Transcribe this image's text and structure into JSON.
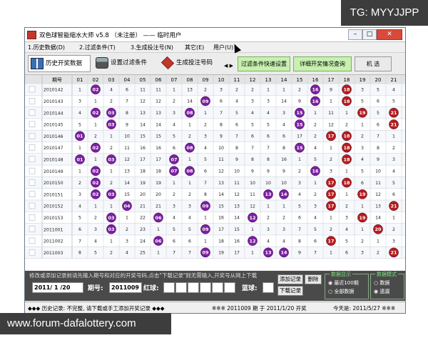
{
  "watermark_top": "TG: MYYJJPP",
  "watermark_bottom": "www.forum-dafalottery.com",
  "window": {
    "title": "双色球智能缩水大师 v5.8 （未注册） —— 临时用户",
    "min": "–",
    "max": "□",
    "close": "✕"
  },
  "menu": [
    "1.历史数据(D)",
    "2.过滤条件(T)",
    "3.生成投注号(N)",
    "其它(E)",
    "用户(U)"
  ],
  "toolbar": {
    "history": "历史开奖数据",
    "filter": "设置过滤条件",
    "generate": "生成投注号码",
    "scroll": "◀ ▶",
    "quick_filter": "过滤条件快速设置",
    "detail": "详细开奖情况查询",
    "machine": "机 选"
  },
  "grid": {
    "issue_header": "期号",
    "columns": [
      "01",
      "02",
      "03",
      "04",
      "05",
      "06",
      "07",
      "08",
      "09",
      "10",
      "11",
      "12",
      "13",
      "14",
      "15",
      "16",
      "17",
      "18",
      "19",
      "20",
      "21"
    ],
    "rows": [
      {
        "issue": "2010142",
        "cells": [
          "1",
          "02",
          "4",
          "6",
          "11",
          "11",
          "1",
          "13",
          "2",
          "3",
          "2",
          "2",
          "1",
          "1",
          "2",
          "16",
          "9",
          "18",
          "3",
          "5",
          "4"
        ],
        "balls": [
          1,
          15,
          17
        ]
      },
      {
        "issue": "2010143",
        "cells": [
          "3",
          "1",
          "2",
          "7",
          "12",
          "12",
          "2",
          "14",
          "09",
          "6",
          "4",
          "3",
          "3",
          "14",
          "9",
          "16",
          "1",
          "18",
          "5",
          "6",
          "5"
        ],
        "balls": [
          8,
          15,
          17
        ]
      },
      {
        "issue": "2010144",
        "cells": [
          "4",
          "02",
          "03",
          "8",
          "13",
          "13",
          "3",
          "08",
          "1",
          "7",
          "5",
          "4",
          "4",
          "3",
          "15",
          "1",
          "11",
          "1",
          "19",
          "5",
          "21"
        ],
        "balls": [
          1,
          2,
          7,
          14,
          18,
          20
        ]
      },
      {
        "issue": "2010145",
        "cells": [
          "5",
          "1",
          "03",
          "9",
          "14",
          "14",
          "4",
          "1",
          "2",
          "8",
          "6",
          "5",
          "5",
          "4",
          "15",
          "2",
          "12",
          "2",
          "1",
          "6",
          "21"
        ],
        "balls": [
          2,
          14,
          20
        ]
      },
      {
        "issue": "2010146",
        "cells": [
          "01",
          "2",
          "1",
          "10",
          "15",
          "15",
          "5",
          "2",
          "3",
          "9",
          "7",
          "6",
          "6",
          "6",
          "17",
          "2",
          "17",
          "18",
          "2",
          "7",
          "1"
        ],
        "balls": [
          0,
          16,
          17
        ]
      },
      {
        "issue": "2010147",
        "cells": [
          "1",
          "02",
          "2",
          "11",
          "16",
          "16",
          "6",
          "08",
          "4",
          "10",
          "8",
          "7",
          "7",
          "8",
          "15",
          "4",
          "1",
          "18",
          "3",
          "8",
          "2"
        ],
        "balls": [
          1,
          7,
          14,
          17
        ]
      },
      {
        "issue": "2010148",
        "cells": [
          "01",
          "1",
          "03",
          "12",
          "17",
          "17",
          "07",
          "1",
          "5",
          "11",
          "9",
          "8",
          "8",
          "16",
          "1",
          "5",
          "2",
          "18",
          "4",
          "9",
          "3"
        ],
        "balls": [
          0,
          2,
          6,
          17
        ]
      },
      {
        "issue": "2010149",
        "cells": [
          "1",
          "02",
          "1",
          "13",
          "18",
          "18",
          "07",
          "08",
          "6",
          "12",
          "10",
          "9",
          "9",
          "9",
          "2",
          "16",
          "3",
          "1",
          "5",
          "10",
          "4"
        ],
        "balls": [
          1,
          6,
          7,
          15
        ]
      },
      {
        "issue": "2010150",
        "cells": [
          "2",
          "02",
          "2",
          "14",
          "19",
          "19",
          "1",
          "1",
          "7",
          "13",
          "11",
          "10",
          "10",
          "10",
          "3",
          "1",
          "17",
          "18",
          "6",
          "11",
          "5"
        ],
        "balls": [
          1,
          16,
          17
        ]
      },
      {
        "issue": "2010151",
        "cells": [
          "3",
          "02",
          "03",
          "15",
          "20",
          "20",
          "2",
          "2",
          "8",
          "14",
          "12",
          "11",
          "13",
          "14",
          "4",
          "2",
          "17",
          "1",
          "19",
          "12",
          "6"
        ],
        "balls": [
          1,
          2,
          12,
          13,
          16,
          18
        ]
      },
      {
        "issue": "2010152",
        "cells": [
          "4",
          "1",
          "1",
          "04",
          "21",
          "21",
          "3",
          "3",
          "09",
          "15",
          "13",
          "12",
          "1",
          "1",
          "5",
          "3",
          "17",
          "2",
          "1",
          "13",
          "21"
        ],
        "balls": [
          3,
          8,
          16,
          20
        ]
      },
      {
        "issue": "2010153",
        "cells": [
          "5",
          "2",
          "03",
          "1",
          "22",
          "06",
          "4",
          "4",
          "1",
          "16",
          "14",
          "12",
          "2",
          "2",
          "6",
          "4",
          "1",
          "3",
          "19",
          "14",
          "1"
        ],
        "balls": [
          2,
          5,
          11,
          18
        ]
      },
      {
        "issue": "2011001",
        "cells": [
          "6",
          "3",
          "03",
          "2",
          "23",
          "1",
          "5",
          "5",
          "09",
          "17",
          "15",
          "1",
          "3",
          "3",
          "7",
          "5",
          "2",
          "4",
          "1",
          "20",
          "2"
        ],
        "balls": [
          2,
          8,
          19
        ]
      },
      {
        "issue": "2011002",
        "cells": [
          "7",
          "4",
          "1",
          "3",
          "24",
          "06",
          "6",
          "6",
          "1",
          "18",
          "16",
          "12",
          "4",
          "4",
          "8",
          "6",
          "17",
          "5",
          "2",
          "1",
          "3"
        ],
        "balls": [
          5,
          11,
          16
        ]
      },
      {
        "issue": "2011003",
        "cells": [
          "8",
          "5",
          "2",
          "4",
          "25",
          "1",
          "7",
          "7",
          "09",
          "19",
          "17",
          "1",
          "13",
          "14",
          "9",
          "7",
          "1",
          "6",
          "3",
          "2",
          "21"
        ],
        "balls": [
          8,
          12,
          13,
          20
        ]
      }
    ]
  },
  "bottom": {
    "hint": "修改或添加记录前请先输入期号和对应的开奖号码,点击\"下载记录\"则无需输入,开奖号从网上下载",
    "date": "2011/ 1 /20",
    "issue_label": "期号:",
    "issue_value": "2011009",
    "red_label": "红球:",
    "blue_label": "蓝球:",
    "add_record": "添加记录",
    "delete": "删除",
    "download": "下载记录",
    "display_title": "数据显示",
    "display_options": [
      "最近100期",
      "全部数据"
    ],
    "mode_title": "数据模式",
    "mode_options": [
      "数据",
      "遗漏"
    ]
  },
  "status": {
    "left": "◆◆◆ 历史记录: 不完整, 请下载或手工添加开奖记录 ◆◆◆",
    "middle": "※※※ 2011009 期 于 2011/1/20 开奖",
    "right": "今天是: 2011/5/27 ※※※"
  }
}
